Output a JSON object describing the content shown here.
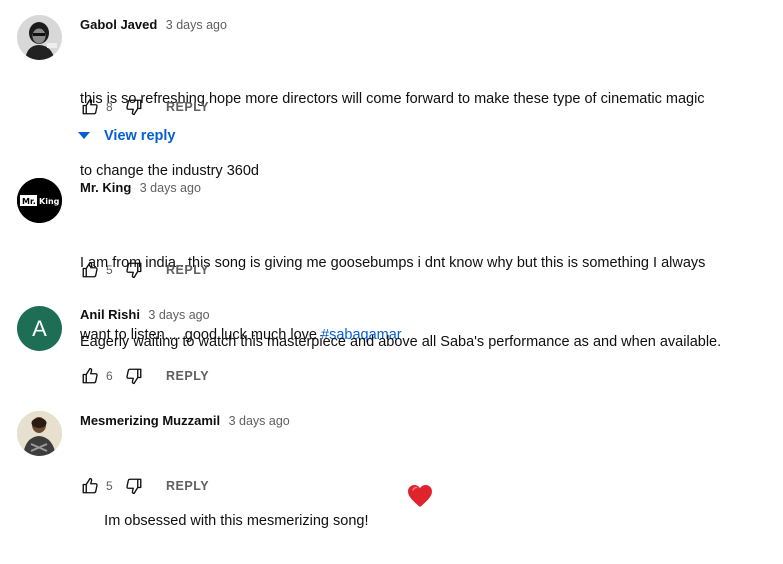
{
  "comments": [
    {
      "author": "Gabol Javed",
      "time": "3 days ago",
      "text_lines": [
        "this is so refreshing hope more directors will come forward to make these type of cinematic magic",
        "to change the industry 360d"
      ],
      "likes": "8",
      "reply_label": "REPLY",
      "view_reply_label": "View reply"
    },
    {
      "author": "Mr. King",
      "time": "3 days ago",
      "text_line1": "I am from india...this song is giving me goosebumps i dnt know why but this is something I always",
      "text_line2_prefix": "want to listen.... good luck much love ",
      "hashtag": "#sabaqamar",
      "avatar_text_left": "Mr.",
      "avatar_text_right": "King",
      "likes": "5",
      "reply_label": "REPLY"
    },
    {
      "author": "Anil Rishi",
      "time": "3 days ago",
      "text": "Eagerly waiting to watch this masterpiece and above all Saba's performance as and when available.",
      "avatar_letter": "A",
      "avatar_color": "#1e6e56",
      "likes": "6",
      "reply_label": "REPLY"
    },
    {
      "author": "Mesmerizing Muzzamil",
      "time": "3 days ago",
      "text": "Im obsessed with this mesmerizing song!",
      "emoji": "heart-emoji",
      "likes": "5",
      "reply_label": "REPLY"
    }
  ],
  "colors": {
    "link": "#065fd4",
    "secondary_text": "#606060",
    "heart": "#e0242e"
  }
}
